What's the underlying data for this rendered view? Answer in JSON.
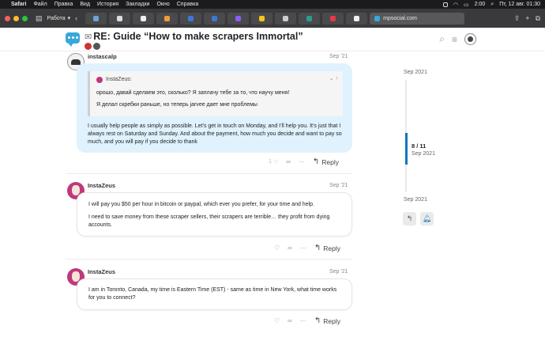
{
  "menubar": {
    "app": "Safari",
    "items": [
      "Файл",
      "Правка",
      "Вид",
      "История",
      "Закладки",
      "Окно",
      "Справка"
    ],
    "time": "2:00",
    "date": "Пт, 12 авг. 01:30"
  },
  "toolbar": {
    "group_label": "Работа",
    "url": "mpsocial.com"
  },
  "topic": {
    "title": "RE: Guide “How to make scrapers Immortal”"
  },
  "posts": [
    {
      "username": "instascalp",
      "date": "Sep '21",
      "quote": {
        "author": "InstaZeus:",
        "lines": [
          "орошо, давай сделаем это, сколько? Я заплачу тебе за то, что научу меня!",
          "Я делал скребки раньше, но теперь jarvee дает мне проблемы"
        ]
      },
      "body": [
        "I usually help people as simply as possible. Let’s get in touch on Monday, and I’ll help you. It’s just that I always rest on Saturday and Sunday. And about the payment, how much you decide and want to pay so much, and you will pay if you decide to thank"
      ],
      "like_count": "1",
      "reply_label": "Reply"
    },
    {
      "username": "InstaZeus",
      "date": "Sep '21",
      "body": [
        "I will pay you $50 per hour in bitcoin or paypal, which ever you prefer, for your time and help.",
        "I need to save money from these scraper sellers, their scrapers are terrible… they profit from dying accounts."
      ],
      "reply_label": "Reply"
    },
    {
      "username": "InstaZeus",
      "date": "Sep '21",
      "body": [
        "I am in Toronto, Canada, my time is Eastern Time (EST) - same as time in New York, what time works for you to connect?"
      ],
      "reply_label": "Reply"
    }
  ],
  "timeline": {
    "start_date": "Sep 2021",
    "position": "8 / 11",
    "position_date": "Sep 2021",
    "end_date": "Sep 2021"
  }
}
